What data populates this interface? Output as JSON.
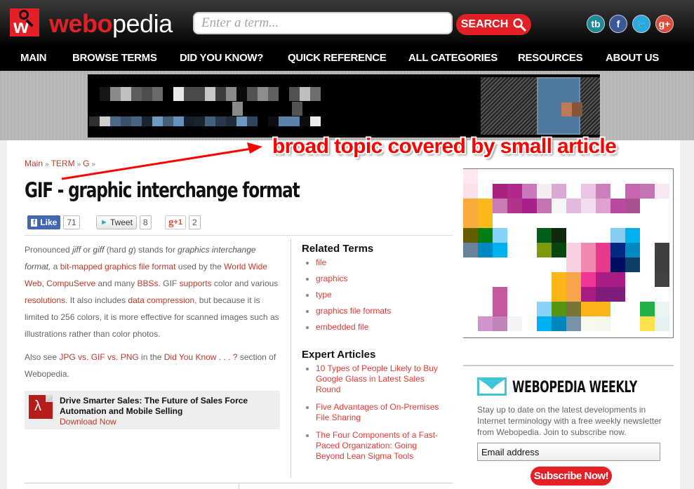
{
  "header": {
    "logo_text_bold": "webo",
    "logo_text_light": "pedia",
    "logo_mark_letter": "w",
    "search_placeholder": "Enter a term...",
    "search_button": "SEARCH",
    "social": [
      {
        "name": "tb",
        "label": "tb",
        "color": "#1d8a9a"
      },
      {
        "name": "facebook",
        "label": "f",
        "color": "#3b5998"
      },
      {
        "name": "twitter",
        "label": "🐦",
        "color": "#2aa9e0"
      },
      {
        "name": "google-plus",
        "label": "g+",
        "color": "#dd4b39"
      }
    ]
  },
  "nav": [
    "MAIN",
    "BROWSE TERMS",
    "DID YOU KNOW?",
    "QUICK REFERENCE",
    "ALL CATEGORIES",
    "RESOURCES",
    "ABOUT US"
  ],
  "annotation": "broad topic covered by small article",
  "breadcrumb": [
    "Main",
    "TERM",
    "G"
  ],
  "breadcrumb_sep": "»",
  "article": {
    "title": "GIF - graphic interchange format",
    "share": {
      "like_label": "Like",
      "like_count": "71",
      "tweet_label": "Tweet",
      "tweet_count": "8",
      "gplus_label": "+1",
      "gplus_count": "2"
    },
    "body": [
      {
        "t": "text",
        "v": "Pronounced "
      },
      {
        "t": "i",
        "v": "jiff"
      },
      {
        "t": "text",
        "v": " or "
      },
      {
        "t": "i",
        "v": "giff"
      },
      {
        "t": "text",
        "v": " (hard "
      },
      {
        "t": "i",
        "v": "g"
      },
      {
        "t": "text",
        "v": ") stands for "
      },
      {
        "t": "i",
        "v": "graphics interchange format,"
      },
      {
        "t": "text",
        "v": " a "
      },
      {
        "t": "a",
        "v": "bit-mapped graphics file format"
      },
      {
        "t": "text",
        "v": " used by the "
      },
      {
        "t": "a",
        "v": "World Wide Web"
      },
      {
        "t": "text",
        "v": ", "
      },
      {
        "t": "a",
        "v": "CompuServe"
      },
      {
        "t": "text",
        "v": " and many "
      },
      {
        "t": "a",
        "v": "BBSs"
      },
      {
        "t": "text",
        "v": ". GIF "
      },
      {
        "t": "a",
        "v": "supports"
      },
      {
        "t": "text",
        "v": " color and various "
      },
      {
        "t": "a",
        "v": "resolutions"
      },
      {
        "t": "text",
        "v": ". It also includes "
      },
      {
        "t": "a",
        "v": "data compression"
      },
      {
        "t": "text",
        "v": ", but because it is limited to 256 colors, it is more effective for scanned images such as illustrations rather than color photos."
      }
    ],
    "also_see": [
      {
        "t": "text",
        "v": "Also see "
      },
      {
        "t": "a",
        "v": "JPG vs. GIF vs. PNG"
      },
      {
        "t": "text",
        "v": " in the "
      },
      {
        "t": "a",
        "v": "Did You Know . . . ?"
      },
      {
        "t": "text",
        "v": " section of Webopedia."
      }
    ],
    "promo": {
      "title": "Drive Smarter Sales: The Future of Sales Force Automation and Mobile Selling",
      "link": "Download Now"
    }
  },
  "related_terms": {
    "heading": "Related Terms",
    "items": [
      "file",
      "graphics",
      "type",
      "graphics file formats",
      "embedded file"
    ]
  },
  "expert_articles": {
    "heading": "Expert Articles",
    "items": [
      "10 Types of People Likely to Buy Google Glass in Latest Sales Round",
      "Five Advantages of On-Premises File Sharing",
      "The Four Components of a Fast-Paced Organization: Going Beyond Lean Sigma Tools"
    ]
  },
  "newsletter": {
    "title": "WEBOPEDIA WEEKLY",
    "text": "Stay up to date on the latest developments in Internet terminology with a free weekly newsletter from Webopedia. Join to subscribe now.",
    "email_placeholder": "Email address",
    "button": "Subscribe Now!"
  },
  "colors": {
    "brand_red": "#e42027",
    "link_red": "#c0392b",
    "teal": "#3fc6d6"
  }
}
